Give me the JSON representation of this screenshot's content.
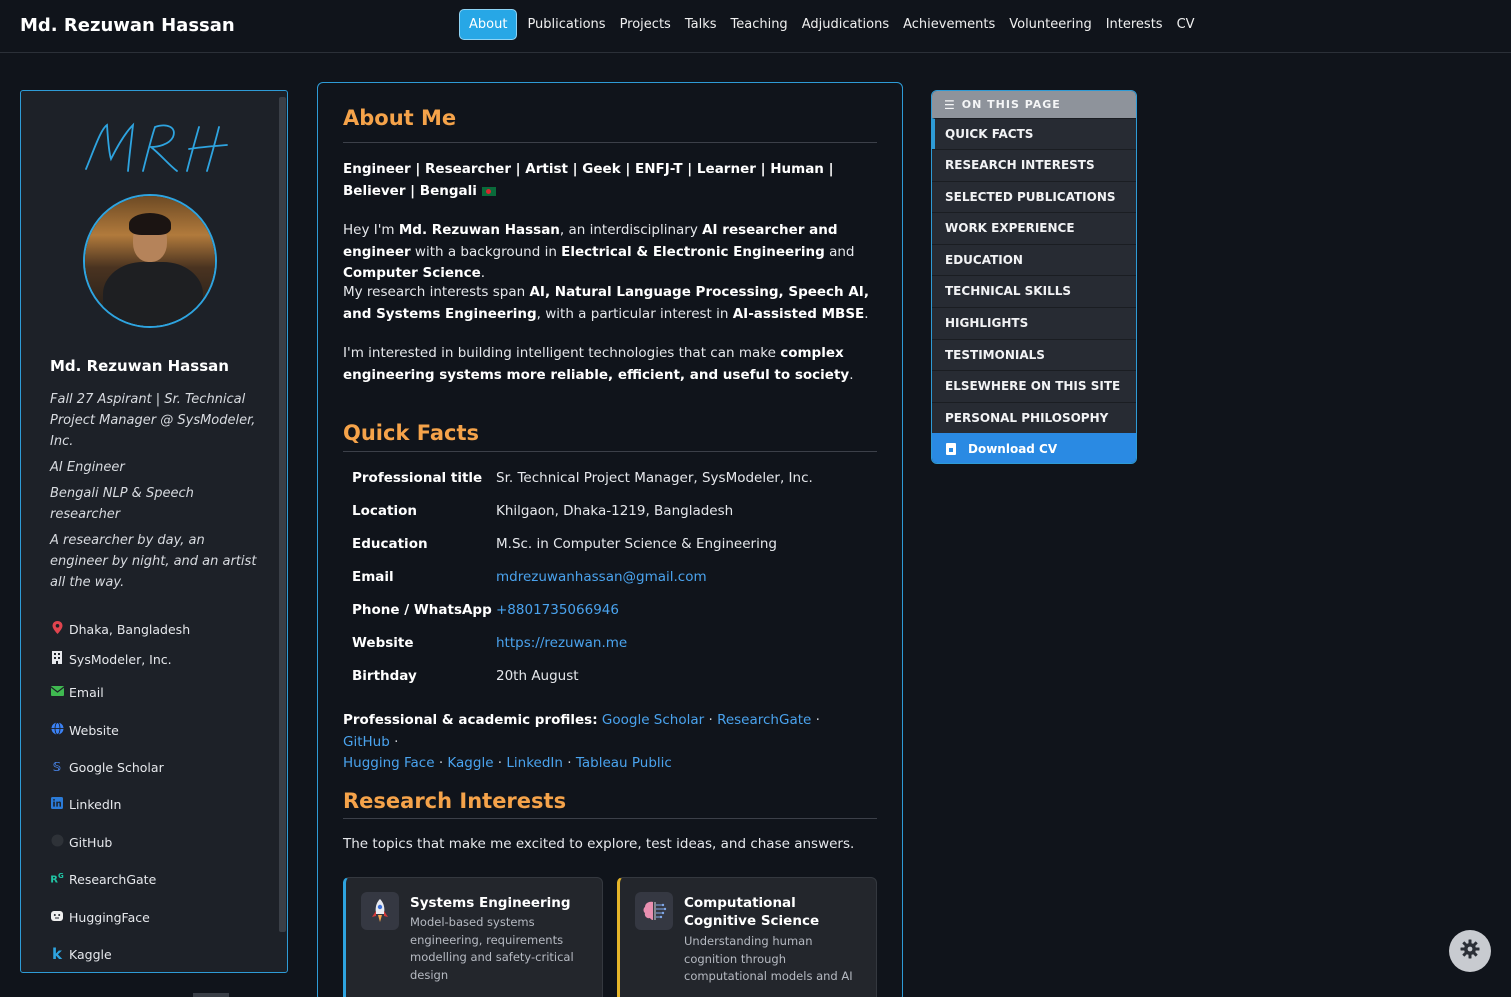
{
  "header": {
    "brand": "Md. Rezuwan Hassan",
    "nav": [
      "About",
      "Publications",
      "Projects",
      "Talks",
      "Teaching",
      "Adjudications",
      "Achievements",
      "Volunteering",
      "Interests",
      "CV"
    ],
    "active": "About"
  },
  "sidebar": {
    "signature": "MRH",
    "name": "Md. Rezuwan Hassan",
    "bio": [
      "Fall 27 Aspirant | Sr. Technical Project Manager @ SysModeler, Inc.",
      "AI Engineer",
      "Bengali NLP & Speech researcher",
      "A researcher by day, an engineer by night, and an artist all the way."
    ],
    "links": [
      {
        "label": "Dhaka, Bangladesh",
        "icon": "location-pin-icon",
        "color": "#e0444e"
      },
      {
        "label": "SysModeler, Inc.",
        "icon": "building-icon",
        "color": "#e6e8ec"
      },
      {
        "label": "Email",
        "icon": "envelope-icon",
        "color": "#3fb950"
      },
      {
        "label": "Website",
        "icon": "globe-icon",
        "color": "#3b82f6"
      },
      {
        "label": "Google Scholar",
        "icon": "google-scholar-icon",
        "color": "#4a8af4"
      },
      {
        "label": "LinkedIn",
        "icon": "linkedin-icon",
        "color": "#2b7bd8"
      },
      {
        "label": "GitHub",
        "icon": "github-icon",
        "color": "#2e3238"
      },
      {
        "label": "ResearchGate",
        "icon": "researchgate-icon",
        "color": "#20c5a5"
      },
      {
        "label": "HuggingFace",
        "icon": "huggingface-icon",
        "color": "#f0f0f0"
      },
      {
        "label": "Kaggle",
        "icon": "kaggle-icon",
        "color": "#2ea4e0"
      }
    ]
  },
  "main": {
    "about_title": "About Me",
    "tagline": "Engineer | Researcher | Artist | Geek | ENFJ-T | Learner | Human | Believer | Bengali",
    "intro": {
      "p1_a": "Hey I'm ",
      "p1_name": "Md. Rezuwan Hassan",
      "p1_b": ", an interdisciplinary ",
      "p1_role": "AI researcher and engineer",
      "p1_c": " with a background in ",
      "p1_eee": "Electrical & Electronic Engineering",
      "p1_d": " and ",
      "p1_cs": "Computer Science",
      "p1_e": ".",
      "p2_a": "My research interests span ",
      "p2_fields": "AI, Natural Language Processing, Speech AI, and Systems Engineering",
      "p2_b": ", with a particular interest in ",
      "p2_mbse": "AI-assisted MBSE",
      "p2_c": ".",
      "p3_a": "I'm interested in building intelligent technologies that can make ",
      "p3_goal": "complex engineering systems more reliable, efficient, and useful to society",
      "p3_b": "."
    },
    "quick_facts_title": "Quick Facts",
    "facts": [
      {
        "label": "Professional title",
        "value": "Sr. Technical Project Manager, SysModeler, Inc.",
        "link": false
      },
      {
        "label": "Location",
        "value": "Khilgaon, Dhaka-1219, Bangladesh",
        "link": false
      },
      {
        "label": "Education",
        "value": "M.Sc. in Computer Science & Engineering",
        "link": false
      },
      {
        "label": "Email",
        "value": "mdrezuwanhassan@gmail.com",
        "link": true
      },
      {
        "label": "Phone / WhatsApp",
        "value": "+8801735066946",
        "link": true
      },
      {
        "label": "Website",
        "value": "https://rezuwan.me",
        "link": true
      },
      {
        "label": "Birthday",
        "value": "20th August",
        "link": false
      }
    ],
    "profiles_label": "Professional & academic profiles:",
    "profiles": [
      "Google Scholar",
      "ResearchGate",
      "GitHub",
      "Hugging Face",
      "Kaggle",
      "LinkedIn",
      "Tableau Public"
    ],
    "research_title": "Research Interests",
    "research_intro": "The topics that make me excited to explore, test ideas, and chase answers.",
    "cards": [
      {
        "title": "Systems Engineering",
        "desc": "Model-based systems engineering, requirements modelling and safety-critical design",
        "icon": "rocket-icon"
      },
      {
        "title": "Computational Cognitive Science",
        "desc": "Understanding human cognition through computational models and AI",
        "icon": "brain-icon"
      }
    ]
  },
  "toc": {
    "heading": "ON THIS PAGE",
    "items": [
      "QUICK FACTS",
      "RESEARCH INTERESTS",
      "SELECTED PUBLICATIONS",
      "WORK EXPERIENCE",
      "EDUCATION",
      "TECHNICAL SKILLS",
      "HIGHLIGHTS",
      "TESTIMONIALS",
      "ELSEWHERE ON THIS SITE",
      "PERSONAL PHILOSOPHY"
    ],
    "download": "Download CV"
  },
  "colors": {
    "accent": "#2e9bd6",
    "heading": "#f5a34a",
    "link": "#4aa3ee",
    "background": "#10141b"
  }
}
